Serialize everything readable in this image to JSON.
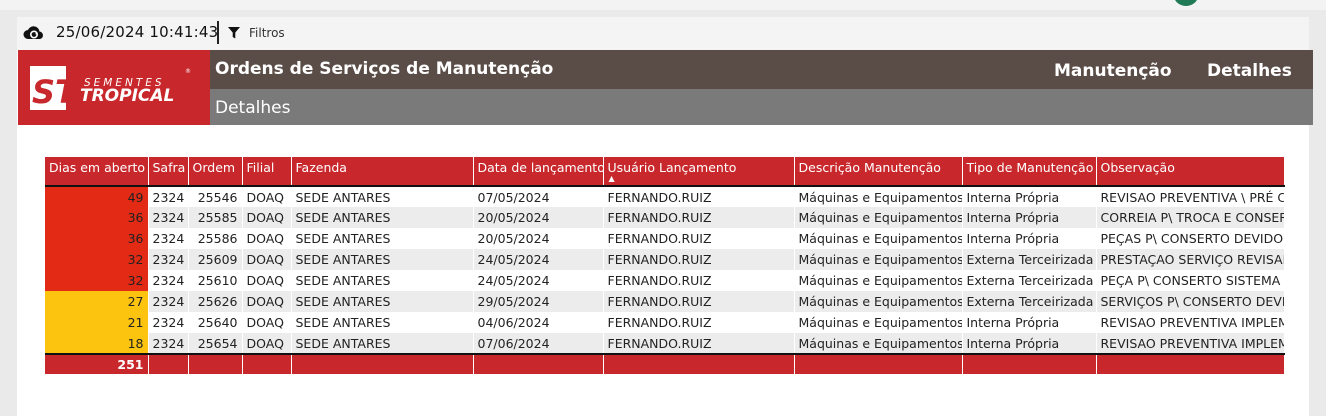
{
  "toolbar": {
    "datetime": "25/06/2024 10:41:43",
    "filter_label": "Filtros"
  },
  "header": {
    "logo_sub": "SEMENTES",
    "logo_main": "TROPICAL",
    "logo_mark": "ST",
    "title": "Ordens de Serviços de Manutenção",
    "subtitle": "Detalhes",
    "nav": [
      "Manutenção",
      "Detalhes"
    ]
  },
  "colors": {
    "brand_red": "#c8272b",
    "header_brown": "#5a4d48",
    "header_gray": "#7a7a7a",
    "status_red": "#e22a14",
    "status_yellow": "#fcc40e"
  },
  "table": {
    "columns": [
      "Dias em aberto",
      "Safra",
      "Ordem",
      "Filial",
      "Fazenda",
      "Data de lançamento",
      "Usuário Lançamento",
      "Descrição Manutenção",
      "Tipo de Manutenção",
      "Observação"
    ],
    "sorted_column": "Usuário Lançamento",
    "rows": [
      {
        "dias": "49",
        "status": "red",
        "safra": "2324",
        "ordem": "25546",
        "filial": "DOAQ",
        "fazenda": "SEDE ANTARES",
        "data": "07/05/2024",
        "usuario": "FERNANDO.RUIZ",
        "descricao": "Máquinas e Equipamentos",
        "tipo": "Interna Própria",
        "obs": "REVISAO PREVENTIVA \\ PRÉ CO"
      },
      {
        "dias": "36",
        "status": "red",
        "safra": "2324",
        "ordem": "25585",
        "filial": "DOAQ",
        "fazenda": "SEDE ANTARES",
        "data": "20/05/2024",
        "usuario": "FERNANDO.RUIZ",
        "descricao": "Máquinas e Equipamentos",
        "tipo": "Interna Própria",
        "obs": "CORREIA P\\ TROCA E CONSERT"
      },
      {
        "dias": "36",
        "status": "red",
        "safra": "2324",
        "ordem": "25586",
        "filial": "DOAQ",
        "fazenda": "SEDE ANTARES",
        "data": "20/05/2024",
        "usuario": "FERNANDO.RUIZ",
        "descricao": "Máquinas e Equipamentos",
        "tipo": "Interna Própria",
        "obs": "PEÇAS P\\ CONSERTO DEVIDO C"
      },
      {
        "dias": "32",
        "status": "red",
        "safra": "2324",
        "ordem": "25609",
        "filial": "DOAQ",
        "fazenda": "SEDE ANTARES",
        "data": "24/05/2024",
        "usuario": "FERNANDO.RUIZ",
        "descricao": "Máquinas e Equipamentos",
        "tipo": "Externa Terceirizada",
        "obs": "PRESTAÇAO SERVIÇO REVISAR"
      },
      {
        "dias": "32",
        "status": "red",
        "safra": "2324",
        "ordem": "25610",
        "filial": "DOAQ",
        "fazenda": "SEDE ANTARES",
        "data": "24/05/2024",
        "usuario": "FERNANDO.RUIZ",
        "descricao": "Máquinas e Equipamentos",
        "tipo": "Externa Terceirizada",
        "obs": "PEÇA P\\ CONSERTO SISTEMA C"
      },
      {
        "dias": "27",
        "status": "yellow",
        "safra": "2324",
        "ordem": "25626",
        "filial": "DOAQ",
        "fazenda": "SEDE ANTARES",
        "data": "29/05/2024",
        "usuario": "FERNANDO.RUIZ",
        "descricao": "Máquinas e Equipamentos",
        "tipo": "Externa Terceirizada",
        "obs": "SERVIÇOS P\\ CONSERTO DEVID"
      },
      {
        "dias": "21",
        "status": "yellow",
        "safra": "2324",
        "ordem": "25640",
        "filial": "DOAQ",
        "fazenda": "SEDE ANTARES",
        "data": "04/06/2024",
        "usuario": "FERNANDO.RUIZ",
        "descricao": "Máquinas e Equipamentos",
        "tipo": "Interna Própria",
        "obs": "REVISAO PREVENTIVA IMPLEM"
      },
      {
        "dias": "18",
        "status": "yellow",
        "safra": "2324",
        "ordem": "25654",
        "filial": "DOAQ",
        "fazenda": "SEDE ANTARES",
        "data": "07/06/2024",
        "usuario": "FERNANDO.RUIZ",
        "descricao": "Máquinas e Equipamentos",
        "tipo": "Interna Própria",
        "obs": "REVISAO PREVENTIVA IMPLEM"
      }
    ],
    "total": "251"
  }
}
